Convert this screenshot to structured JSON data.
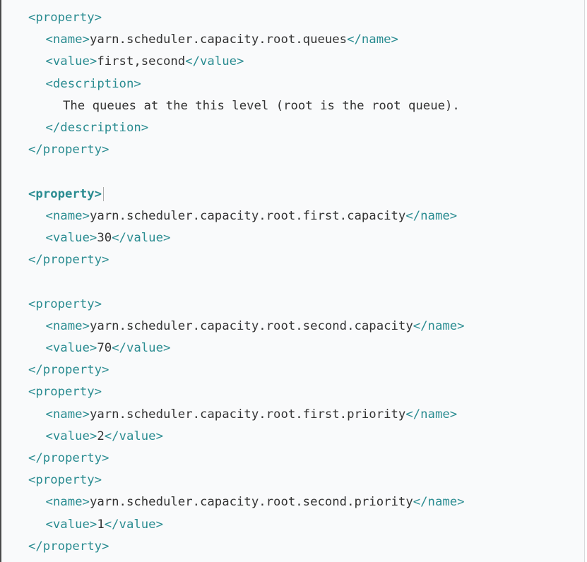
{
  "code_lines": [
    {
      "indent": 0,
      "open": "<property>"
    },
    {
      "indent": 1,
      "open": "<name>",
      "text": "yarn.scheduler.capacity.root.queues",
      "close": "</name>"
    },
    {
      "indent": 1,
      "open": "<value>",
      "text": "first,second",
      "close": "</value>"
    },
    {
      "indent": 1,
      "open": "<description>"
    },
    {
      "indent": 2,
      "text": "The queues at the this level (root is the root queue)."
    },
    {
      "indent": 1,
      "close": "</description>"
    },
    {
      "indent": 0,
      "close": "</property>"
    },
    {
      "blank": true
    },
    {
      "indent": 0,
      "open": "<property>",
      "highlight": true,
      "cursor": true
    },
    {
      "indent": 1,
      "open": "<name>",
      "text": "yarn.scheduler.capacity.root.first.capacity",
      "close": "</name>"
    },
    {
      "indent": 1,
      "open": "<value>",
      "text": "30",
      "close": "</value>"
    },
    {
      "indent": 0,
      "close": "</property>"
    },
    {
      "blank": true
    },
    {
      "indent": 0,
      "open": "<property>"
    },
    {
      "indent": 1,
      "open": "<name>",
      "text": "yarn.scheduler.capacity.root.second.capacity",
      "close": "</name>"
    },
    {
      "indent": 1,
      "open": "<value>",
      "text": "70",
      "close": "</value>"
    },
    {
      "indent": 0,
      "close": "</property>"
    },
    {
      "indent": 0,
      "open": "<property>"
    },
    {
      "indent": 1,
      "open": "<name>",
      "text": "yarn.scheduler.capacity.root.first.priority",
      "close": "</name>"
    },
    {
      "indent": 1,
      "open": "<value>",
      "text": "2",
      "close": "</value>"
    },
    {
      "indent": 0,
      "close": "</property>"
    },
    {
      "indent": 0,
      "open": "<property>"
    },
    {
      "indent": 1,
      "open": "<name>",
      "text": "yarn.scheduler.capacity.root.second.priority",
      "close": "</name>"
    },
    {
      "indent": 1,
      "open": "<value>",
      "text": "1",
      "close": "</value>"
    },
    {
      "indent": 0,
      "close": "</property>"
    }
  ],
  "colors": {
    "tag": "#2a8c91",
    "text": "#333333",
    "background": "#f9fafb"
  }
}
